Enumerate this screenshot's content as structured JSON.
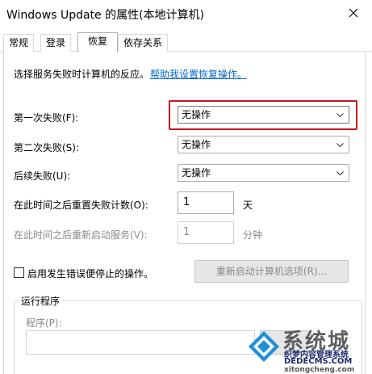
{
  "window": {
    "title": "Windows Update 的属性(本地计算机)"
  },
  "tabs": [
    {
      "label": "常规"
    },
    {
      "label": "登录"
    },
    {
      "label": "恢复"
    },
    {
      "label": "依存关系"
    }
  ],
  "recovery": {
    "intro_text": "选择服务失败时计算机的反应。",
    "help_link": "帮助我设置恢复操作。",
    "first_failure_label": "第一次失败(F):",
    "first_failure_value": "无操作",
    "second_failure_label": "第二次失败(S):",
    "second_failure_value": "无操作",
    "subsequent_failures_label": "后续失败(U):",
    "subsequent_failures_value": "无操作",
    "reset_count_label": "在此时间之后重置失败计数(O):",
    "reset_count_value": "1",
    "reset_count_unit": "天",
    "restart_service_label": "在此时间之后重新启动服务(V):",
    "restart_service_value": "1",
    "restart_service_unit": "分钟",
    "enable_actions_label": "启用发生错误便停止的操作。",
    "restart_computer_options_button": "重新启动计算机选项(R)...",
    "run_program_group": "运行程序",
    "program_label": "程序(P):"
  },
  "watermark": {
    "big_text": "系统城",
    "line1": "织梦内容管理系统",
    "line2": "DEDECMS.COM",
    "line3": "xitongcheng.com"
  },
  "colors": {
    "highlight_frame": "#c8161d",
    "link": "#0066cc"
  }
}
